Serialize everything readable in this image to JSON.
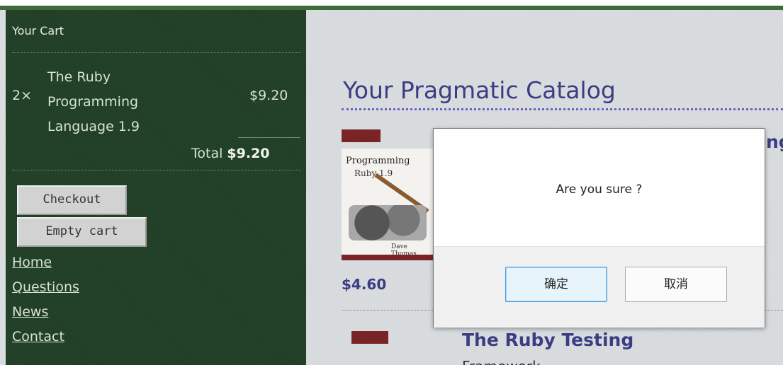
{
  "cart": {
    "title": "Your Cart",
    "item": {
      "quantity": "2×",
      "title": "The Ruby Programming Language 1.9",
      "price": "$9.20"
    },
    "total_label": "Total",
    "total_value": "$9.20",
    "checkout_label": "Checkout",
    "empty_label": "Empty cart"
  },
  "nav": {
    "links": [
      "Home",
      "Questions",
      "News",
      "Contact"
    ]
  },
  "catalog": {
    "title": "Your Pragmatic Catalog",
    "product1": {
      "cover_title": "Programming",
      "cover_subtitle": "Ruby 1.9",
      "cover_author": "Dave Thomas",
      "price": "$4.60",
      "title_fragment": "ng"
    },
    "product2": {
      "title": "The Ruby Testing",
      "subtitle": "Framework"
    }
  },
  "dialog": {
    "message": "Are you sure ?",
    "ok_label": "确定",
    "cancel_label": "取消"
  },
  "colors": {
    "sidebar_bg": "#1f3d24",
    "heading": "#3b3d82",
    "dialog_focus": "#3c9ee6"
  }
}
